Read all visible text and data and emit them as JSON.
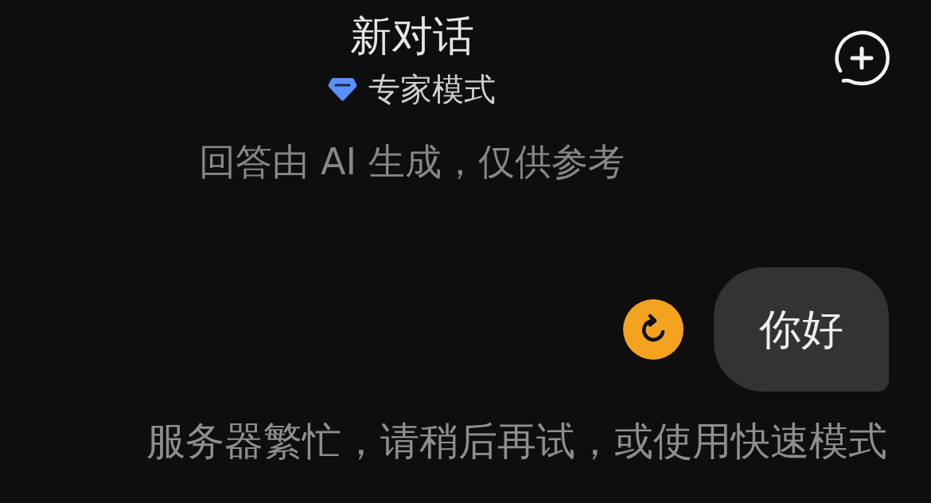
{
  "header": {
    "title": "新对话",
    "mode": "专家模式",
    "disclaimer": "回答由 AI 生成，仅供参考"
  },
  "messages": [
    {
      "kind": "user",
      "text": "你好",
      "failed": true
    },
    {
      "kind": "notice",
      "text": "服务器繁忙，请稍后再试，或使用快速模式"
    }
  ]
}
